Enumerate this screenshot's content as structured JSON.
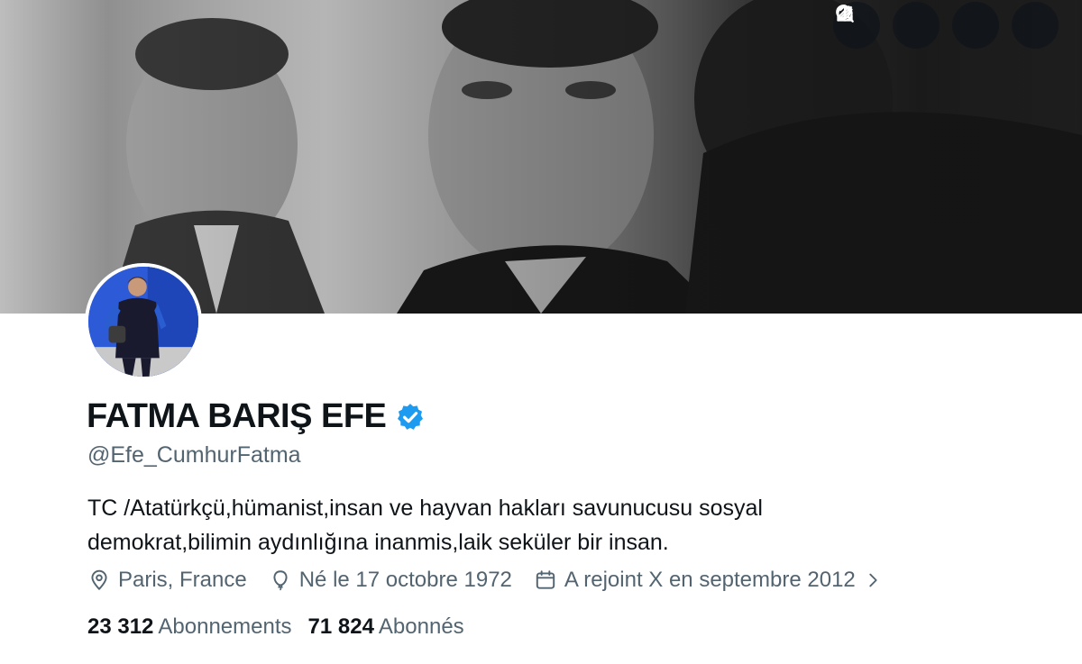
{
  "header_actions": [
    {
      "icon": "grok-icon",
      "name": "grok-button"
    },
    {
      "icon": "search-icon",
      "name": "search-button"
    },
    {
      "icon": "edit-icon",
      "name": "edit-button"
    },
    {
      "icon": "share-icon",
      "name": "share-button"
    }
  ],
  "profile": {
    "display_name": "FATMA BARIŞ EFE",
    "verified": true,
    "verified_color": "#1d9bf0",
    "handle": "@Efe_CumhurFatma",
    "bio_line1": "TC /Atatürkçü,hümanist,insan ve hayvan hakları savunucusu sosyal",
    "bio_line2": "demokrat,bilimin aydınlığına inanmis,laik seküler bir insan.",
    "location": "Paris, France",
    "birth": "Né le 17 octobre 1972",
    "joined": "A rejoint X en septembre 2012"
  },
  "stats": {
    "following_count": "23 312",
    "following_label": "Abonnements",
    "followers_count": "71 824",
    "followers_label": "Abonnés"
  },
  "colors": {
    "text_primary": "#0f1419",
    "text_secondary": "#536471",
    "button_overlay": "#0f1419"
  }
}
